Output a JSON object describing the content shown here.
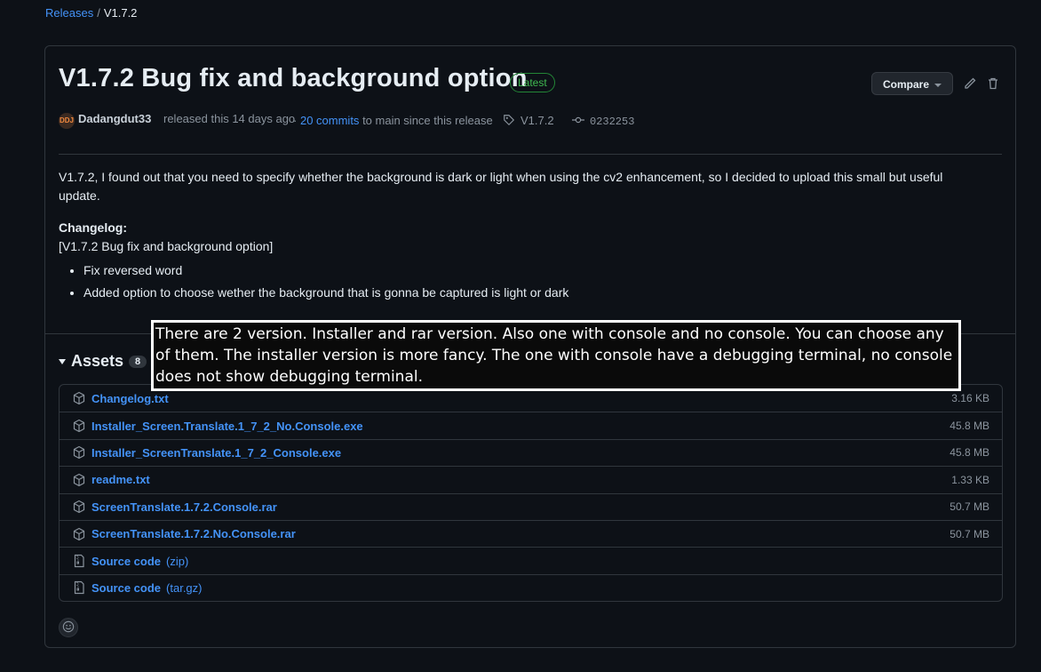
{
  "breadcrumb": {
    "releases": "Releases",
    "separator": "/",
    "current": "V1.7.2"
  },
  "release": {
    "title": "V1.7.2 Bug fix and background option",
    "badge": "Latest",
    "compare_label": "Compare",
    "avatar_text": "DDJ",
    "user": "Dadangdut33",
    "released_text": "released this 14 days ago",
    "commits_prefix": "·",
    "commits_link": "20 commits",
    "commits_suffix": "to main since this release",
    "tag": "V1.7.2",
    "sha": "0232253",
    "description": "V1.7.2, I found out that you need to specify whether the background is dark or light when using the cv2 enhancement, so I decided to upload this small but useful update.",
    "changelog_heading": "Changelog:",
    "changelog_sub": "[V1.7.2 Bug fix and background option]",
    "bullets": [
      "Fix reversed word",
      "Added option to choose wether the background that is gonna be captured is light or dark"
    ]
  },
  "assets": {
    "heading": "Assets",
    "count": "8",
    "items": [
      {
        "name": "Changelog.txt",
        "ext": "",
        "size": "3.16 KB",
        "icon": "package-icon"
      },
      {
        "name": "Installer_Screen.Translate.1_7_2_No.Console.exe",
        "ext": "",
        "size": "45.8 MB",
        "icon": "package-icon"
      },
      {
        "name": "Installer_ScreenTranslate.1_7_2_Console.exe",
        "ext": "",
        "size": "45.8 MB",
        "icon": "package-icon"
      },
      {
        "name": "readme.txt",
        "ext": "",
        "size": "1.33 KB",
        "icon": "package-icon"
      },
      {
        "name": "ScreenTranslate.1.7.2.Console.rar",
        "ext": "",
        "size": "50.7 MB",
        "icon": "package-icon"
      },
      {
        "name": "ScreenTranslate.1.7.2.No.Console.rar",
        "ext": "",
        "size": "50.7 MB",
        "icon": "package-icon"
      },
      {
        "name": "Source code",
        "ext": "(zip)",
        "size": "",
        "icon": "file-zip-icon"
      },
      {
        "name": "Source code",
        "ext": "(tar.gz)",
        "size": "",
        "icon": "file-zip-icon"
      }
    ]
  },
  "overlay_text": "There are 2 version. Installer and rar version. Also one with console and no console. You can choose any of them. The installer version is more fancy. The one with console have a debugging terminal, no console does not show debugging terminal."
}
